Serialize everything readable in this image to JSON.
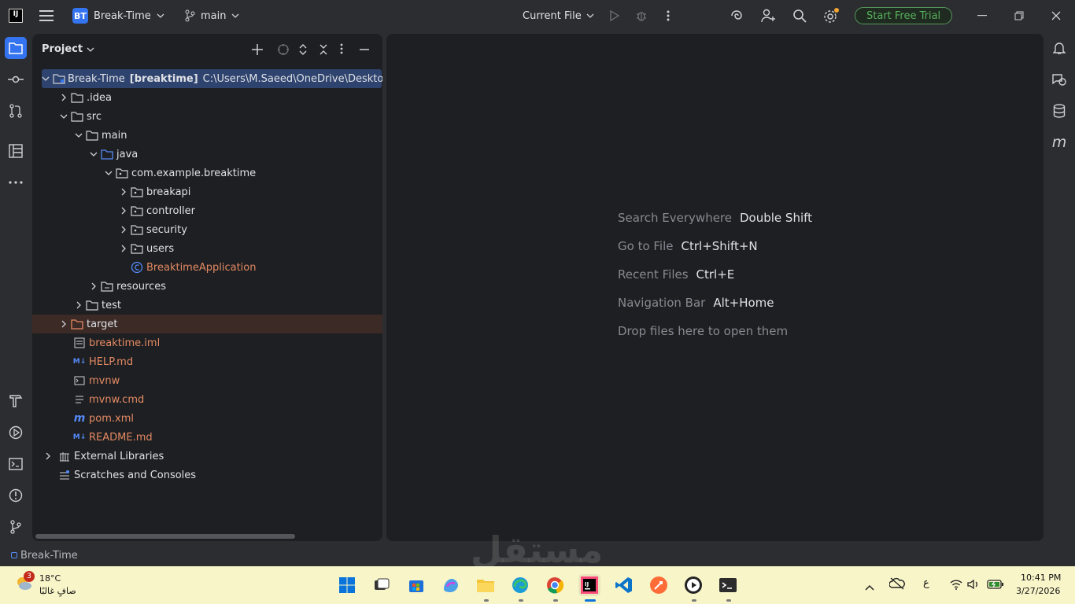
{
  "titlebar": {
    "project_badge": "BT",
    "project_name": "Break-Time",
    "branch": "main",
    "run_config": "Current File",
    "trial_button": "Start Free Trial"
  },
  "project_panel": {
    "title": "Project",
    "rows": [
      {
        "label": "Break-Time",
        "bold": "[breaktime]",
        "path": "C:\\Users\\M.Saeed\\OneDrive\\Desktop\\"
      },
      {
        "label": ".idea"
      },
      {
        "label": "src"
      },
      {
        "label": "main"
      },
      {
        "label": "java"
      },
      {
        "label": "com.example.breaktime"
      },
      {
        "label": "breakapi"
      },
      {
        "label": "controller"
      },
      {
        "label": "security"
      },
      {
        "label": "users"
      },
      {
        "label": "BreaktimeApplication"
      },
      {
        "label": "resources"
      },
      {
        "label": "test"
      },
      {
        "label": "target"
      },
      {
        "label": "breaktime.iml"
      },
      {
        "label": "HELP.md"
      },
      {
        "label": "mvnw"
      },
      {
        "label": "mvnw.cmd"
      },
      {
        "label": "pom.xml"
      },
      {
        "label": "README.md"
      },
      {
        "label": "External Libraries"
      },
      {
        "label": "Scratches and Consoles"
      }
    ]
  },
  "editor": {
    "hints": [
      {
        "label": "Search Everywhere",
        "shortcut": "Double Shift"
      },
      {
        "label": "Go to File",
        "shortcut": "Ctrl+Shift+N"
      },
      {
        "label": "Recent Files",
        "shortcut": "Ctrl+E"
      },
      {
        "label": "Navigation Bar",
        "shortcut": "Alt+Home"
      },
      {
        "label": "Drop files here to open them",
        "shortcut": ""
      }
    ]
  },
  "statusbar": {
    "project": "Break-Time"
  },
  "taskbar": {
    "weather_temp": "18°C",
    "weather_desc": "صافٍ غالبًا",
    "weather_badge": "3",
    "lang": "ع",
    "time": "10:41 PM",
    "date": "3/27/2026",
    "watermark": "مستقل"
  },
  "colors": {
    "accent": "#3574f0",
    "trial_green": "#57b05c",
    "orange_label": "#e38a63",
    "taskbar_bg": "#f8f5c9"
  }
}
